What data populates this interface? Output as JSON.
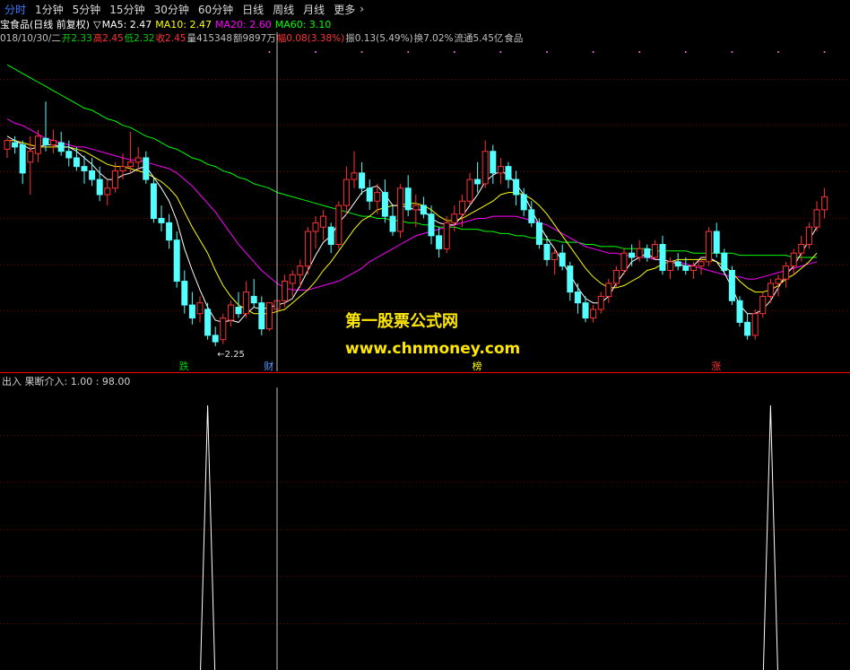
{
  "toolbar": {
    "periods": [
      "分时",
      "1分钟",
      "5分钟",
      "15分钟",
      "30分钟",
      "60分钟",
      "日线",
      "周线",
      "月线",
      "更多"
    ],
    "more_chevron": "›"
  },
  "info": {
    "title": "宝食品(日线 前复权)",
    "triangle": "▽",
    "ma5": "MA5: 2.47",
    "ma10": "MA10: 2.47",
    "ma20": "MA20: 2.60",
    "ma60": "MA60: 3.10",
    "date": "018/10/30/二",
    "open": "开2.33",
    "high": "高2.45",
    "low": "低2.32",
    "close": "收2.45",
    "volume": "量415348",
    "amount": "额9897万",
    "change": "幅0.08(3.38%)",
    "amplitude": "振0.13(5.49%)",
    "turnover": "换7.02%",
    "float": "流通5.45亿",
    "industry": "食品"
  },
  "main": {
    "low_label": "←2.25",
    "markers": [
      "跌",
      "财",
      "榜",
      "涨"
    ]
  },
  "indicator": {
    "label": "出入 果断介入: 1.00 : 98.00"
  },
  "watermark": {
    "line1": "第一股票公式网",
    "line2": "www.chnmoney.com"
  },
  "colors": {
    "up": "#ff3232",
    "down": "#54ffff",
    "ma5": "#ffffff",
    "ma10": "#ffff00",
    "ma20": "#ff00ff",
    "ma60": "#00ff00",
    "grid": "#7a0000",
    "separator": "#ff0000",
    "watermark": "#ffe800",
    "period_active": "#3d7cff"
  },
  "chart_data": {
    "type": "candlestick",
    "ylim": [
      2.2,
      3.7
    ],
    "candles": [
      [
        3.16,
        3.21,
        3.12,
        3.2
      ],
      [
        3.19,
        3.22,
        3.14,
        3.17
      ],
      [
        3.18,
        3.2,
        3.0,
        3.05
      ],
      [
        3.1,
        3.22,
        2.95,
        3.15
      ],
      [
        3.14,
        3.25,
        3.1,
        3.22
      ],
      [
        3.21,
        3.38,
        3.15,
        3.18
      ],
      [
        3.18,
        3.25,
        3.14,
        3.2
      ],
      [
        3.19,
        3.24,
        3.13,
        3.15
      ],
      [
        3.15,
        3.2,
        3.08,
        3.12
      ],
      [
        3.12,
        3.17,
        3.06,
        3.08
      ],
      [
        3.08,
        3.13,
        3.0,
        3.06
      ],
      [
        3.06,
        3.12,
        2.99,
        3.02
      ],
      [
        3.02,
        3.08,
        2.92,
        2.95
      ],
      [
        2.95,
        3.02,
        2.9,
        2.98
      ],
      [
        2.98,
        3.1,
        2.96,
        3.06
      ],
      [
        3.06,
        3.14,
        3.02,
        3.08
      ],
      [
        3.08,
        3.24,
        3.05,
        3.1
      ],
      [
        3.1,
        3.17,
        3.06,
        3.12
      ],
      [
        3.12,
        3.15,
        3.0,
        3.02
      ],
      [
        3.0,
        3.03,
        2.82,
        2.84
      ],
      [
        2.84,
        2.9,
        2.78,
        2.82
      ],
      [
        2.82,
        2.86,
        2.7,
        2.74
      ],
      [
        2.74,
        2.78,
        2.52,
        2.55
      ],
      [
        2.55,
        2.6,
        2.4,
        2.44
      ],
      [
        2.44,
        2.5,
        2.35,
        2.38
      ],
      [
        2.4,
        2.48,
        2.36,
        2.45
      ],
      [
        2.42,
        2.45,
        2.28,
        2.3
      ],
      [
        2.3,
        2.34,
        2.25,
        2.27
      ],
      [
        2.28,
        2.4,
        2.26,
        2.38
      ],
      [
        2.37,
        2.46,
        2.34,
        2.44
      ],
      [
        2.43,
        2.5,
        2.38,
        2.4
      ],
      [
        2.4,
        2.55,
        2.38,
        2.5
      ],
      [
        2.48,
        2.56,
        2.43,
        2.45
      ],
      [
        2.45,
        2.48,
        2.3,
        2.33
      ],
      [
        2.33,
        2.45,
        2.32,
        2.45
      ],
      [
        2.42,
        2.48,
        2.38,
        2.46
      ],
      [
        2.46,
        2.58,
        2.43,
        2.55
      ],
      [
        2.54,
        2.6,
        2.48,
        2.58
      ],
      [
        2.58,
        2.65,
        2.52,
        2.62
      ],
      [
        2.62,
        2.8,
        2.58,
        2.78
      ],
      [
        2.78,
        2.85,
        2.7,
        2.82
      ],
      [
        2.8,
        2.88,
        2.74,
        2.85
      ],
      [
        2.8,
        2.82,
        2.68,
        2.72
      ],
      [
        2.72,
        2.92,
        2.7,
        2.9
      ],
      [
        2.9,
        3.08,
        2.86,
        3.02
      ],
      [
        3.02,
        3.15,
        2.98,
        3.05
      ],
      [
        3.05,
        3.1,
        2.95,
        2.98
      ],
      [
        2.98,
        3.02,
        2.88,
        2.92
      ],
      [
        2.92,
        3.0,
        2.86,
        2.96
      ],
      [
        2.96,
        3.02,
        2.82,
        2.85
      ],
      [
        2.85,
        2.9,
        2.76,
        2.78
      ],
      [
        2.78,
        3.0,
        2.75,
        2.98
      ],
      [
        2.98,
        3.04,
        2.85,
        2.88
      ],
      [
        2.88,
        2.95,
        2.8,
        2.9
      ],
      [
        2.9,
        2.94,
        2.84,
        2.86
      ],
      [
        2.86,
        2.9,
        2.72,
        2.76
      ],
      [
        2.76,
        2.8,
        2.66,
        2.7
      ],
      [
        2.7,
        2.85,
        2.68,
        2.82
      ],
      [
        2.82,
        2.9,
        2.78,
        2.86
      ],
      [
        2.86,
        2.95,
        2.8,
        2.92
      ],
      [
        2.92,
        3.05,
        2.9,
        3.02
      ],
      [
        3.02,
        3.1,
        2.96,
        3.0
      ],
      [
        3.0,
        3.2,
        2.98,
        3.15
      ],
      [
        3.15,
        3.18,
        3.0,
        3.05
      ],
      [
        3.05,
        3.12,
        3.0,
        3.08
      ],
      [
        3.08,
        3.1,
        2.98,
        3.02
      ],
      [
        3.02,
        3.06,
        2.9,
        2.95
      ],
      [
        2.95,
        2.98,
        2.85,
        2.88
      ],
      [
        2.88,
        2.92,
        2.8,
        2.82
      ],
      [
        2.82,
        2.84,
        2.7,
        2.72
      ],
      [
        2.72,
        2.76,
        2.62,
        2.65
      ],
      [
        2.65,
        2.7,
        2.58,
        2.68
      ],
      [
        2.68,
        2.72,
        2.6,
        2.62
      ],
      [
        2.62,
        2.64,
        2.46,
        2.5
      ],
      [
        2.5,
        2.54,
        2.4,
        2.45
      ],
      [
        2.45,
        2.48,
        2.36,
        2.38
      ],
      [
        2.38,
        2.44,
        2.36,
        2.42
      ],
      [
        2.42,
        2.5,
        2.4,
        2.48
      ],
      [
        2.48,
        2.56,
        2.45,
        2.54
      ],
      [
        2.54,
        2.62,
        2.52,
        2.6
      ],
      [
        2.6,
        2.7,
        2.58,
        2.68
      ],
      [
        2.68,
        2.72,
        2.62,
        2.66
      ],
      [
        2.66,
        2.74,
        2.64,
        2.7
      ],
      [
        2.7,
        2.72,
        2.64,
        2.66
      ],
      [
        2.66,
        2.74,
        2.65,
        2.72
      ],
      [
        2.72,
        2.76,
        2.58,
        2.6
      ],
      [
        2.6,
        2.66,
        2.56,
        2.64
      ],
      [
        2.64,
        2.68,
        2.6,
        2.62
      ],
      [
        2.62,
        2.66,
        2.58,
        2.6
      ],
      [
        2.6,
        2.64,
        2.56,
        2.62
      ],
      [
        2.62,
        2.66,
        2.58,
        2.64
      ],
      [
        2.64,
        2.8,
        2.62,
        2.78
      ],
      [
        2.78,
        2.82,
        2.66,
        2.68
      ],
      [
        2.68,
        2.7,
        2.58,
        2.6
      ],
      [
        2.6,
        2.62,
        2.44,
        2.46
      ],
      [
        2.46,
        2.48,
        2.34,
        2.36
      ],
      [
        2.36,
        2.4,
        2.28,
        2.3
      ],
      [
        2.3,
        2.42,
        2.28,
        2.4
      ],
      [
        2.4,
        2.5,
        2.38,
        2.48
      ],
      [
        2.48,
        2.56,
        2.45,
        2.54
      ],
      [
        2.54,
        2.58,
        2.48,
        2.56
      ],
      [
        2.56,
        2.64,
        2.52,
        2.62
      ],
      [
        2.62,
        2.7,
        2.58,
        2.68
      ],
      [
        2.68,
        2.76,
        2.64,
        2.72
      ],
      [
        2.72,
        2.82,
        2.7,
        2.8
      ],
      [
        2.8,
        2.92,
        2.78,
        2.88
      ],
      [
        2.88,
        2.98,
        2.84,
        2.94
      ]
    ],
    "ma5": [
      3.22,
      3.2,
      3.18,
      3.16,
      3.17,
      3.18,
      3.18,
      3.17,
      3.17,
      3.15,
      3.12,
      3.09,
      3.05,
      3.02,
      3.02,
      3.04,
      3.05,
      3.07,
      3.08,
      3.03,
      2.98,
      2.92,
      2.83,
      2.7,
      2.6,
      2.51,
      2.43,
      2.37,
      2.36,
      2.37,
      2.36,
      2.4,
      2.43,
      2.42,
      2.43,
      2.44,
      2.45,
      2.47,
      2.53,
      2.6,
      2.67,
      2.73,
      2.76,
      2.82,
      2.86,
      2.91,
      2.96,
      2.98,
      2.99,
      2.95,
      2.9,
      2.9,
      2.89,
      2.88,
      2.88,
      2.84,
      2.82,
      2.81,
      2.81,
      2.85,
      2.9,
      2.95,
      3.01,
      3.04,
      3.06,
      3.04,
      3.0,
      2.95,
      2.88,
      2.81,
      2.75,
      2.7,
      2.64,
      2.58,
      2.52,
      2.47,
      2.45,
      2.45,
      2.48,
      2.54,
      2.59,
      2.64,
      2.66,
      2.68,
      2.65,
      2.65,
      2.64,
      2.63,
      2.62,
      2.62,
      2.66,
      2.66,
      2.64,
      2.59,
      2.52,
      2.44,
      2.4,
      2.4,
      2.42,
      2.46,
      2.52,
      2.58,
      2.62,
      2.68,
      2.74,
      2.8
    ],
    "ma10": [
      3.2,
      3.2,
      3.19,
      3.18,
      3.17,
      3.17,
      3.17,
      3.17,
      3.17,
      3.16,
      3.15,
      3.13,
      3.11,
      3.09,
      3.08,
      3.08,
      3.07,
      3.06,
      3.05,
      3.03,
      3.01,
      2.98,
      2.94,
      2.87,
      2.8,
      2.74,
      2.68,
      2.6,
      2.53,
      2.48,
      2.44,
      2.42,
      2.4,
      2.4,
      2.4,
      2.41,
      2.42,
      2.45,
      2.48,
      2.51,
      2.55,
      2.6,
      2.64,
      2.69,
      2.74,
      2.79,
      2.83,
      2.85,
      2.88,
      2.89,
      2.9,
      2.9,
      2.91,
      2.91,
      2.9,
      2.88,
      2.85,
      2.83,
      2.83,
      2.84,
      2.86,
      2.88,
      2.9,
      2.92,
      2.95,
      2.96,
      2.96,
      2.95,
      2.93,
      2.9,
      2.86,
      2.81,
      2.76,
      2.71,
      2.66,
      2.61,
      2.57,
      2.54,
      2.52,
      2.52,
      2.53,
      2.55,
      2.57,
      2.6,
      2.61,
      2.63,
      2.64,
      2.65,
      2.65,
      2.65,
      2.65,
      2.65,
      2.64,
      2.62,
      2.59,
      2.55,
      2.52,
      2.5,
      2.5,
      2.51,
      2.53,
      2.56,
      2.58,
      2.61,
      2.64,
      2.68
    ],
    "ma20": [
      3.3,
      3.28,
      3.27,
      3.25,
      3.23,
      3.21,
      3.2,
      3.19,
      3.18,
      3.17,
      3.17,
      3.16,
      3.15,
      3.14,
      3.13,
      3.12,
      3.11,
      3.11,
      3.1,
      3.09,
      3.08,
      3.07,
      3.05,
      3.02,
      2.99,
      2.95,
      2.91,
      2.87,
      2.82,
      2.77,
      2.72,
      2.68,
      2.64,
      2.6,
      2.57,
      2.54,
      2.52,
      2.51,
      2.51,
      2.51,
      2.52,
      2.53,
      2.54,
      2.55,
      2.57,
      2.59,
      2.61,
      2.64,
      2.66,
      2.68,
      2.7,
      2.72,
      2.74,
      2.76,
      2.77,
      2.78,
      2.79,
      2.8,
      2.81,
      2.82,
      2.83,
      2.84,
      2.84,
      2.85,
      2.85,
      2.85,
      2.85,
      2.84,
      2.83,
      2.82,
      2.81,
      2.79,
      2.77,
      2.75,
      2.73,
      2.71,
      2.7,
      2.69,
      2.68,
      2.68,
      2.67,
      2.67,
      2.66,
      2.66,
      2.65,
      2.65,
      2.64,
      2.64,
      2.63,
      2.62,
      2.61,
      2.6,
      2.59,
      2.58,
      2.57,
      2.57,
      2.56,
      2.56,
      2.57,
      2.58,
      2.59,
      2.6,
      2.61,
      2.62,
      2.63,
      2.64
    ],
    "ma60": [
      3.55,
      3.53,
      3.51,
      3.49,
      3.47,
      3.45,
      3.43,
      3.41,
      3.39,
      3.37,
      3.35,
      3.34,
      3.32,
      3.3,
      3.29,
      3.27,
      3.26,
      3.24,
      3.22,
      3.21,
      3.19,
      3.17,
      3.16,
      3.14,
      3.12,
      3.11,
      3.09,
      3.08,
      3.06,
      3.05,
      3.03,
      3.02,
      3.0,
      2.99,
      2.98,
      2.96,
      2.95,
      2.94,
      2.93,
      2.92,
      2.91,
      2.9,
      2.89,
      2.88,
      2.87,
      2.86,
      2.85,
      2.85,
      2.84,
      2.84,
      2.83,
      2.83,
      2.82,
      2.82,
      2.81,
      2.81,
      2.8,
      2.8,
      2.8,
      2.79,
      2.79,
      2.79,
      2.78,
      2.78,
      2.77,
      2.77,
      2.76,
      2.76,
      2.75,
      2.75,
      2.74,
      2.74,
      2.73,
      2.73,
      2.73,
      2.72,
      2.72,
      2.71,
      2.71,
      2.71,
      2.7,
      2.7,
      2.7,
      2.7,
      2.69,
      2.69,
      2.69,
      2.69,
      2.69,
      2.68,
      2.68,
      2.68,
      2.68,
      2.68,
      2.68,
      2.67,
      2.67,
      2.67,
      2.67,
      2.67,
      2.67,
      2.67,
      2.66,
      2.66,
      2.66,
      2.66
    ],
    "sub_ylim": [
      0,
      100
    ],
    "sub_spikes": [
      {
        "index": 26,
        "value": 98
      },
      {
        "index": 99,
        "value": 98
      }
    ]
  }
}
